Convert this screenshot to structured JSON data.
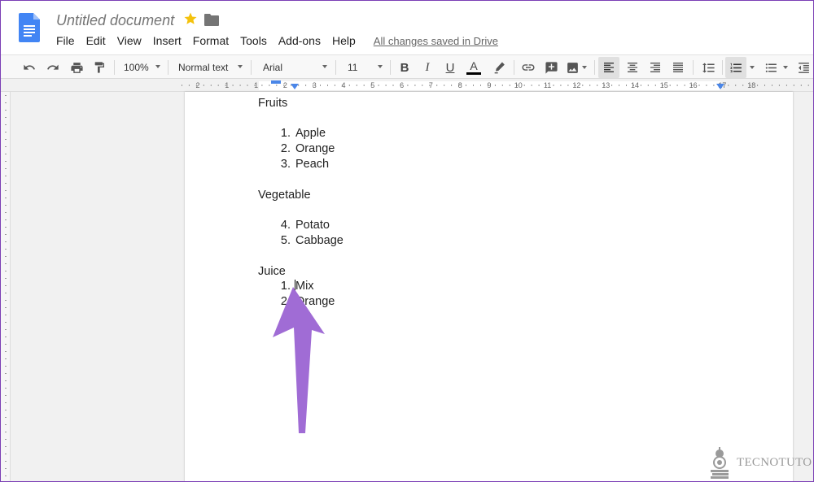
{
  "document": {
    "title": "Untitled document",
    "save_status": "All changes saved in Drive"
  },
  "menu": [
    "File",
    "Edit",
    "View",
    "Insert",
    "Format",
    "Tools",
    "Add-ons",
    "Help"
  ],
  "toolbar": {
    "zoom": "100%",
    "style": "Normal text",
    "font": "Arial",
    "font_size": "11",
    "bold": "B",
    "italic": "I",
    "underline": "U",
    "text_color": "A",
    "active_alignment": "left",
    "active_list": "numbered"
  },
  "ruler": {
    "labels": [
      "2",
      "1",
      "1",
      "2",
      "3",
      "4",
      "5",
      "6",
      "7",
      "8",
      "9",
      "10",
      "11",
      "12",
      "13",
      "14",
      "15",
      "16",
      "17",
      "18"
    ]
  },
  "content": {
    "sections": [
      {
        "heading": "Fruits",
        "items": [
          {
            "num": "1.",
            "text": "Apple"
          },
          {
            "num": "2.",
            "text": "Orange"
          },
          {
            "num": "3.",
            "text": "Peach"
          }
        ]
      },
      {
        "heading": "Vegetable",
        "items": [
          {
            "num": "4.",
            "text": "Potato"
          },
          {
            "num": "5.",
            "text": "Cabbage"
          }
        ]
      },
      {
        "heading": "Juice",
        "items": [
          {
            "num": "1.",
            "text": "Mix"
          },
          {
            "num": "2.",
            "text": "Orange"
          }
        ]
      }
    ]
  },
  "annotation": {
    "color": "#a06cd5",
    "icon": "up-arrow-icon"
  },
  "watermark": {
    "text": "TECNOTUTO"
  },
  "colors": {
    "doc_blue": "#4285f4",
    "star": "#f4c20d",
    "border": "#7b3fb5"
  }
}
